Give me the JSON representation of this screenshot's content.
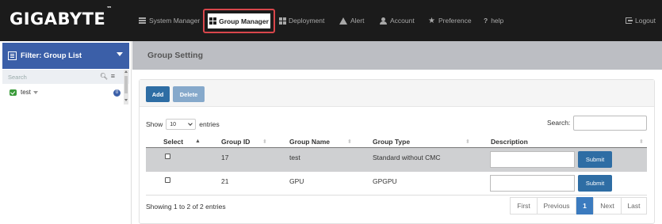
{
  "brand": {
    "name": "GIGABYTE",
    "tm": "™"
  },
  "nav": {
    "items": [
      {
        "label": "System Manager",
        "icon": "list-icon"
      },
      {
        "label": "Group Manager",
        "icon": "grid-icon",
        "active": true
      },
      {
        "label": "Deployment",
        "icon": "grid-icon"
      },
      {
        "label": "Alert",
        "icon": "warning-icon"
      },
      {
        "label": "Account",
        "icon": "user-icon"
      },
      {
        "label": "Preference",
        "icon": "star-icon"
      },
      {
        "label": "help",
        "icon": "question-icon",
        "prefix": "?"
      }
    ],
    "logout": "Logout"
  },
  "sidebar": {
    "filter_label": "Filter:  Group List",
    "search_placeholder": "Search",
    "tree": [
      {
        "label": "test",
        "count": "0"
      }
    ]
  },
  "main": {
    "title": "Group Setting",
    "buttons": {
      "add": "Add",
      "delete": "Delete"
    },
    "show_prefix": "Show",
    "entries_value": "10",
    "show_suffix": "entries",
    "search_label": "Search:",
    "columns": [
      "Select",
      "Group ID",
      "Group Name",
      "Group Type",
      "Description"
    ],
    "rows": [
      {
        "group_id": "17",
        "group_name": "test",
        "group_type": "Standard without CMC",
        "submit": "Submit"
      },
      {
        "group_id": "21",
        "group_name": "GPU",
        "group_type": "GPGPU",
        "submit": "Submit"
      }
    ],
    "info": "Showing 1 to 2 of 2 entries",
    "pagination": {
      "first": "First",
      "previous": "Previous",
      "current": "1",
      "next": "Next",
      "last": "Last"
    }
  },
  "colors": {
    "topbar": "#1b1b1b",
    "accent": "#3b5fa8",
    "button": "#2e6da4",
    "active_outline": "#d9464b"
  }
}
